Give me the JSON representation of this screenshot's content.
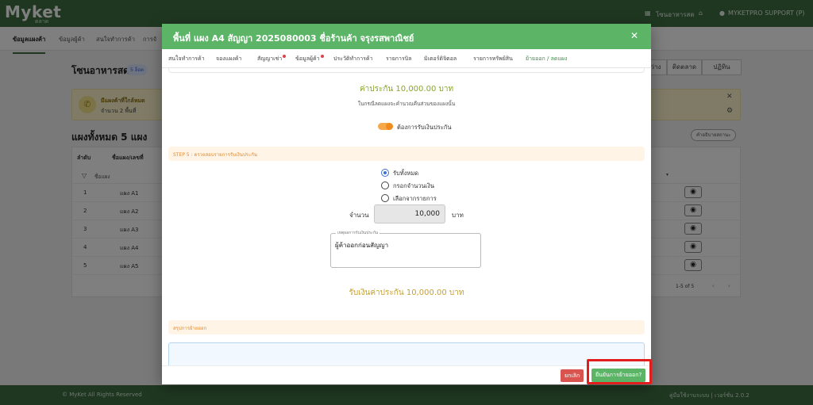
{
  "app": {
    "logo": "Myket",
    "logo_sub": "ตลาด",
    "top_right": {
      "zone": "โซนอาหารสด",
      "user": "MYKETPRO SUPPORT (P)"
    },
    "nav": [
      "ข้อมูลแผงค้า",
      "ข้อมูลผู้ค้า",
      "สนใจทำการค้า",
      "การจั"
    ],
    "zone_title": "โซนอาหารสด",
    "zone_badge": "5 ล็อค",
    "segments": [
      "ว่าง",
      "ติดตลาด",
      "ปฏิทิน"
    ],
    "alert": {
      "title": "มีแผงค้าที่ใกล้หมด",
      "count": "จำนวน 2 พื้นที่"
    },
    "total_label": "แผงทั้งหมด 5 แผง",
    "desc_button": "คำอธิบายสถานะ",
    "table": {
      "headers": [
        "ลำดับ",
        "ชื่อแผง/เลขที่"
      ],
      "filter_placeholder": "ชื่อแผง",
      "rows": [
        {
          "idx": "1",
          "name": "แผง A1"
        },
        {
          "idx": "2",
          "name": "แผง A2"
        },
        {
          "idx": "3",
          "name": "แผง A3"
        },
        {
          "idx": "4",
          "name": "แผง A4"
        },
        {
          "idx": "5",
          "name": "แผง A5"
        }
      ],
      "pager": "1-5 of 5"
    },
    "footer_left": "© MyKet All Rights Reserved",
    "footer_right": "คู่มือใช้งานระบบ | เวอร์ชั่น 2.0.2"
  },
  "modal": {
    "title": "พื้นที่ แผง A4 สัญญา 2025080003 ชื่อร้านค้า จรุงรสพาณิชย์",
    "tabs": [
      {
        "label": "สนใจทำการค้า",
        "dot": false
      },
      {
        "label": "จองแผงค้า",
        "dot": false
      },
      {
        "label": "สัญญาเช่า",
        "dot": true
      },
      {
        "label": "ข้อมูลผู้ค้า",
        "dot": true
      },
      {
        "label": "ประวัติทำการค้า",
        "dot": false
      },
      {
        "label": "รายการบิล",
        "dot": false
      },
      {
        "label": "มิเตอร์ดิจิตอล",
        "dot": false
      },
      {
        "label": "รายการทรัพย์สิน",
        "dot": false
      },
      {
        "label": "ย้ายออก / ลดแผง",
        "dot": false
      }
    ],
    "active_tab": 8,
    "deposit_heading": "ค่าประกัน 10,000.00 บาท",
    "deposit_note": "ในกรณีลดแผงจะคำนวณคืนส่วนของแผงนั้น",
    "toggle": {
      "label": "ต้องการรับเงินประกัน",
      "on": true
    },
    "step5": "STEP 5 : ตรวจสอบรายการรับเงินประกัน",
    "radios": [
      {
        "label": "รับทั้งหมด",
        "checked": true
      },
      {
        "label": "กรอกจำนวนเงิน",
        "checked": false
      },
      {
        "label": "เลือกจากรายการ",
        "checked": false
      }
    ],
    "amount": {
      "label": "จำนวน",
      "value": "10,000",
      "unit": "บาท"
    },
    "reason": {
      "legend": "เหตุผลการรับเงินประกัน",
      "value": "ผู้ค้าออกก่อนสัญญา"
    },
    "receive_total": "รับเงินค่าประกัน 10,000.00 บาท",
    "summary_heading": "สรุปการย้ายออก",
    "preview_text": "",
    "buttons": {
      "cancel": "ยกเลิก",
      "confirm": "ยืนยันการย้ายออก?"
    }
  },
  "colors": {
    "brand_green": "#3e6e43",
    "modal_green": "#5cb566",
    "danger": "#d9534f",
    "highlight": "#e11d1d",
    "step_bg": "#fff4e5"
  }
}
